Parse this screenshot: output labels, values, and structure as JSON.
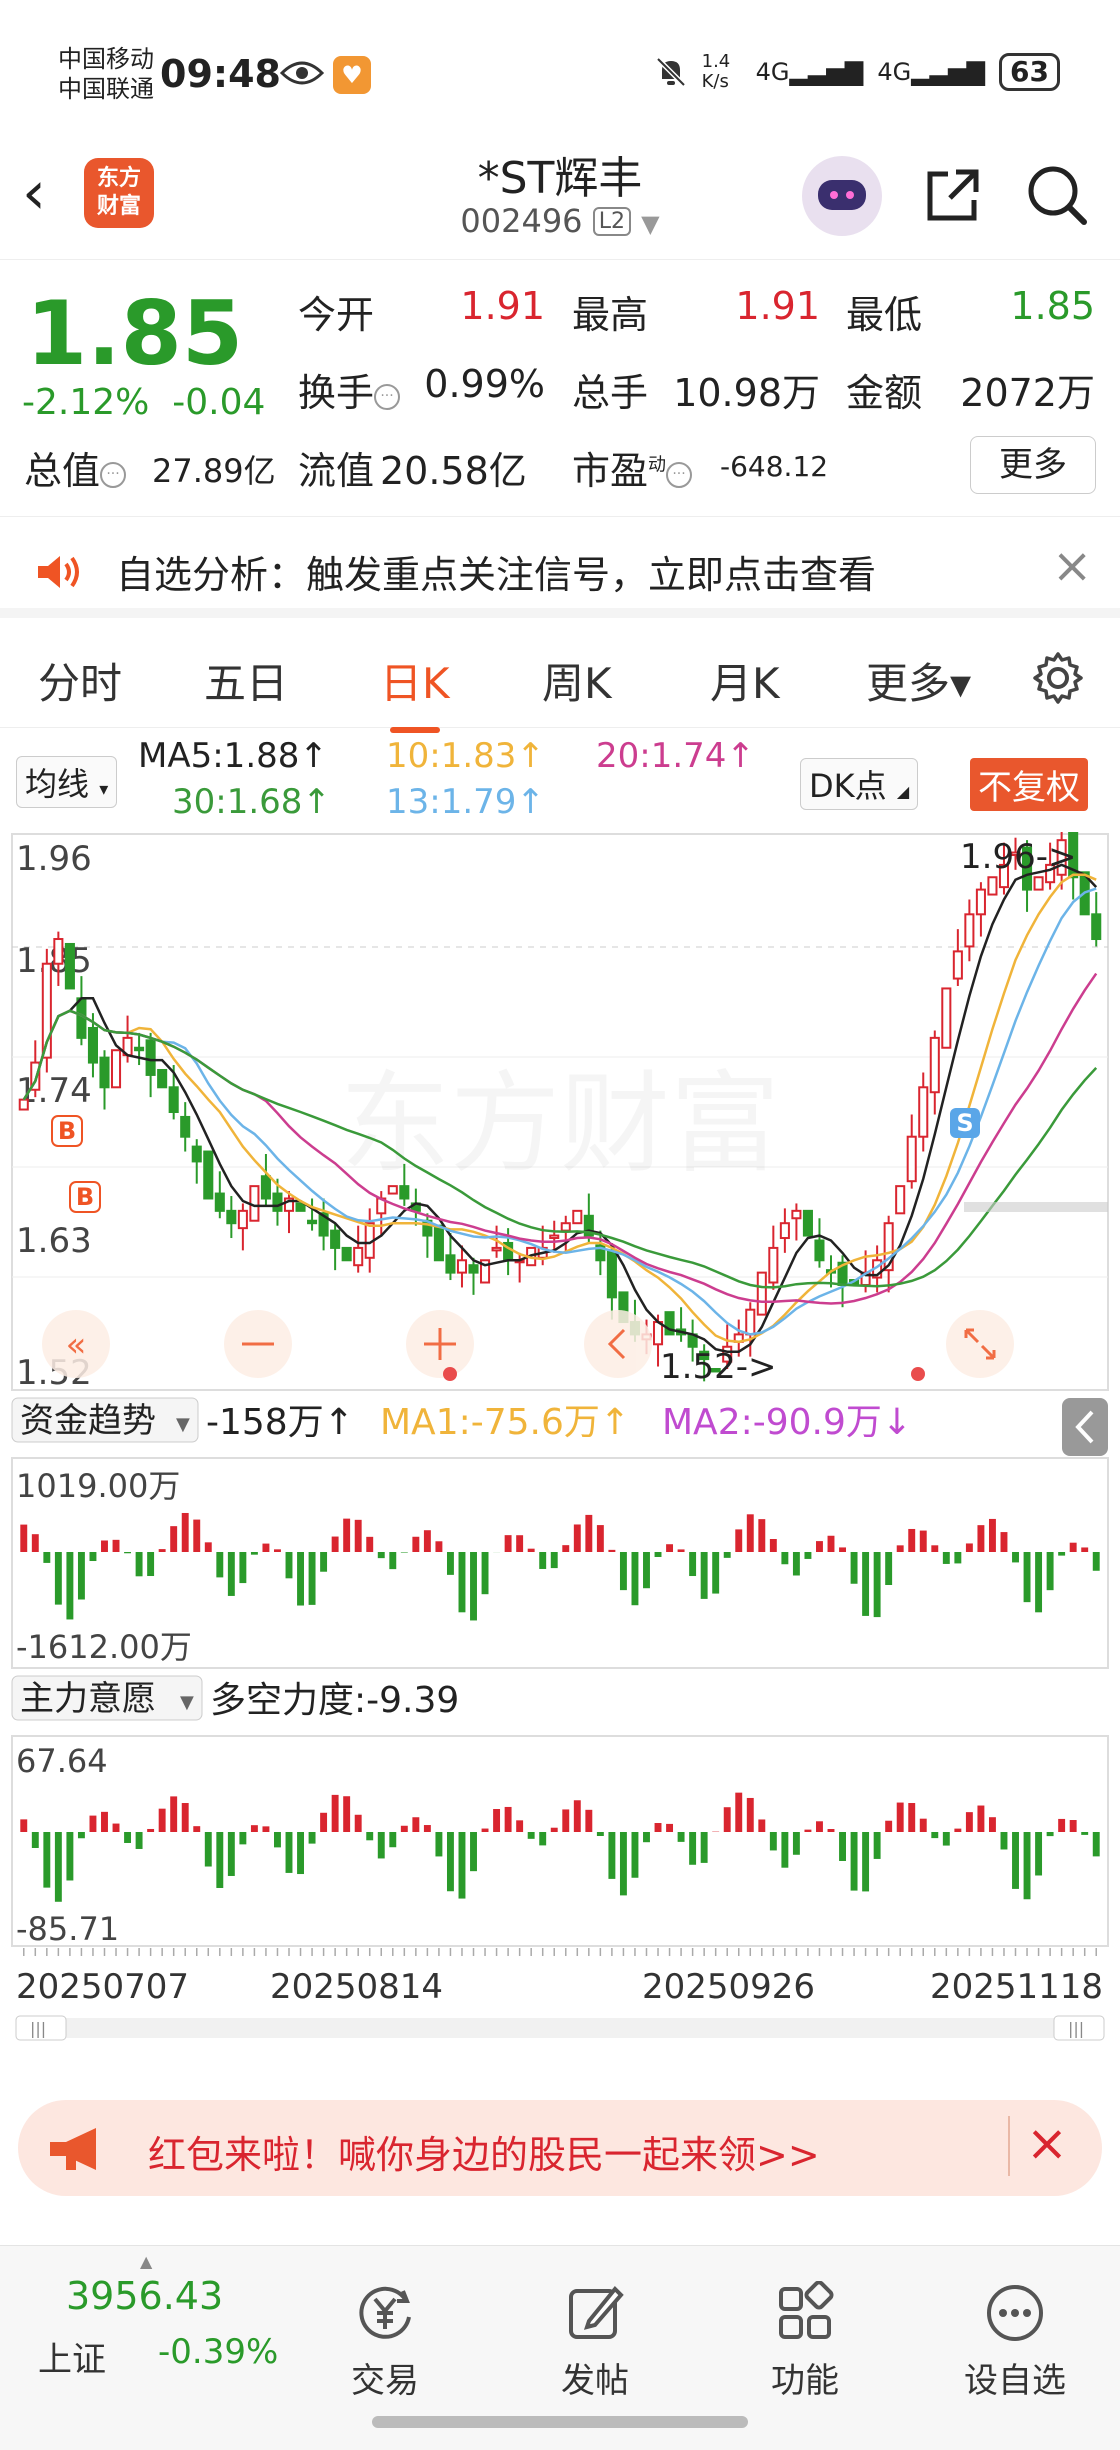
{
  "status": {
    "carrier1": "中国移动",
    "carrier2": "中国联通",
    "time": "09:48",
    "net_speed": "1.4 K/s",
    "signal1": "4G",
    "signal2": "4G",
    "battery": "63"
  },
  "header": {
    "logo_line1": "东方",
    "logo_line2": "财富",
    "name": "*ST辉丰",
    "code": "002496",
    "level": "L2"
  },
  "quote": {
    "price": "1.85",
    "change_pct": "-2.12%",
    "change": "-0.04",
    "open_label": "今开",
    "open": "1.91",
    "high_label": "最高",
    "high": "1.91",
    "low_label": "最低",
    "low": "1.85",
    "turnover_label": "换手",
    "turnover": "0.99%",
    "volume_label": "总手",
    "volume": "10.98万",
    "amount_label": "金额",
    "amount": "2072万",
    "mktcap_label": "总值",
    "mktcap": "27.89亿",
    "float_label": "流值",
    "float_cap": "20.58亿",
    "pe_label": "市盈",
    "pe_sup": "动",
    "pe": "-648.12",
    "more": "更多"
  },
  "alert": {
    "text": "自选分析：触发重点关注信号，立即点击查看"
  },
  "tabs": [
    {
      "label": "分时"
    },
    {
      "label": "五日"
    },
    {
      "label": "日K"
    },
    {
      "label": "周K"
    },
    {
      "label": "月K"
    },
    {
      "label": "更多▾"
    }
  ],
  "ma": {
    "select": "均线",
    "ma5": "MA5:1.88↑",
    "ma10": "10:1.83↑",
    "ma20": "20:1.74↑",
    "ma30": "30:1.68↑",
    "ma13": "13:1.79↑",
    "dk": "DK点",
    "fq": "不复权"
  },
  "chart": {
    "y_top": "1.96",
    "y_mid1": "1.85",
    "y_mid2": "1.74",
    "y_mid3": "1.63",
    "y_bottom": "1.52",
    "high_marker": "1.96->",
    "low_marker": "1.52->",
    "buy_mark": "B",
    "sell_mark": "S",
    "watermark": "东方财富",
    "colors": {
      "ma5": "#222222",
      "ma10": "#f0b43a",
      "ma20": "#cc3d8f",
      "ma30": "#3a9a3a",
      "ma13": "#6cb4e8",
      "up": "#d9252f",
      "down": "#2a9a2a"
    }
  },
  "fund": {
    "select": "资金趋势",
    "value": "-158万↑",
    "ma1": "MA1:-75.6万↑",
    "ma2": "MA2:-90.9万↓",
    "top": "1019.00万",
    "bottom": "-1612.00万"
  },
  "force": {
    "select": "主力意愿",
    "value": "多空力度:-9.39",
    "top": "67.64",
    "bottom": "-85.71"
  },
  "dates": [
    "20250707",
    "20250814",
    "20250926",
    "20251118"
  ],
  "redpack": {
    "text": "红包来啦！喊你身边的股民一起来领>>"
  },
  "bottom": {
    "index_value": "3956.43",
    "index_name": "上证",
    "index_change": "-0.39%",
    "nav": [
      {
        "label": "交易"
      },
      {
        "label": "发帖"
      },
      {
        "label": "功能"
      },
      {
        "label": "设自选"
      }
    ]
  }
}
